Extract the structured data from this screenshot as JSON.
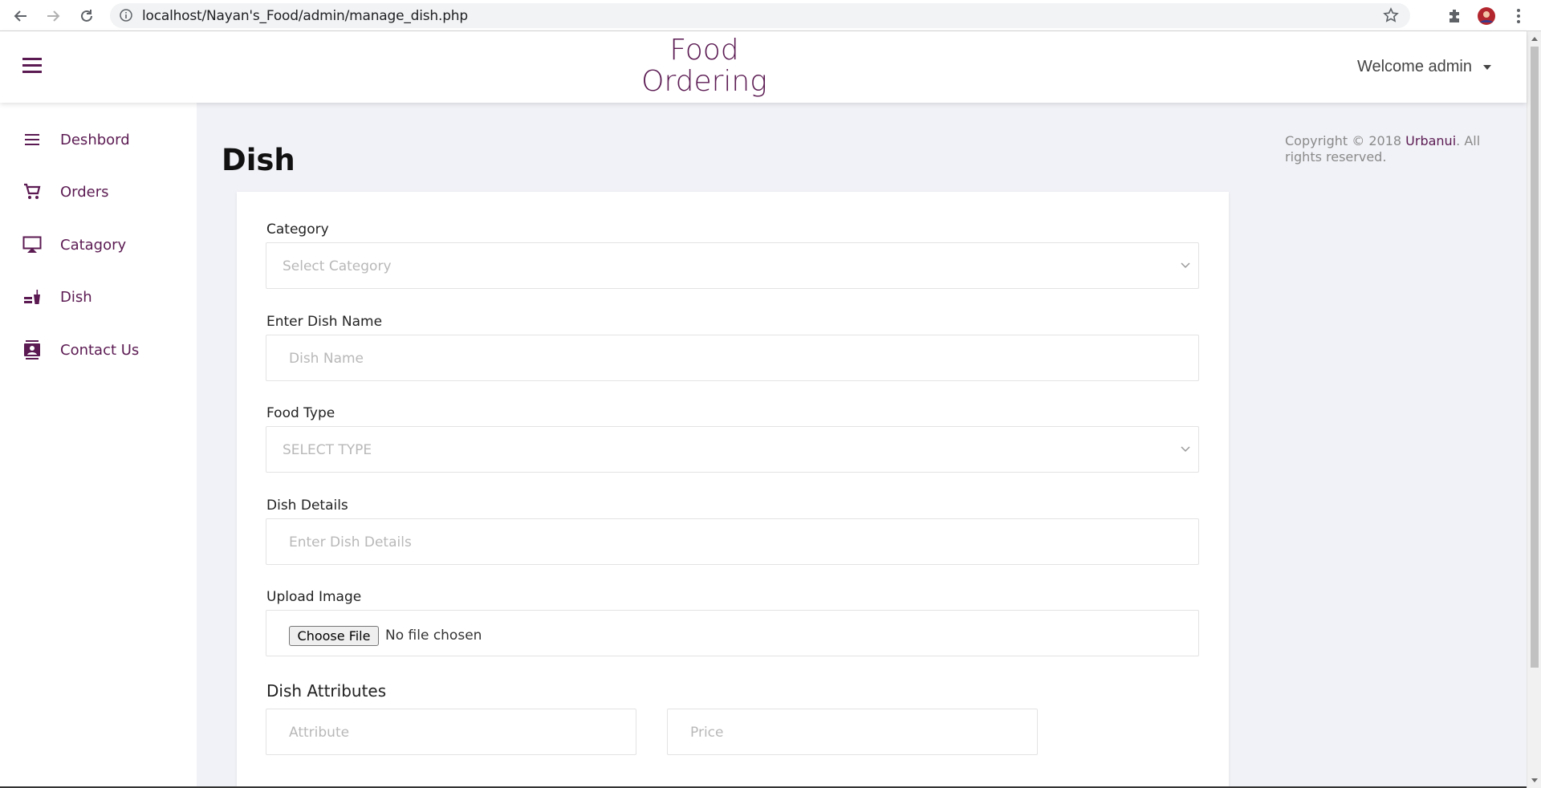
{
  "browser": {
    "url": "localhost/Nayan's_Food/admin/manage_dish.php"
  },
  "header": {
    "brand_line1": "Food",
    "brand_line2": "Ordering",
    "user_greeting": "Welcome admin"
  },
  "sidebar": {
    "items": [
      {
        "label": "Deshbord",
        "icon": "menu-icon"
      },
      {
        "label": "Orders",
        "icon": "cart-icon"
      },
      {
        "label": "Catagory",
        "icon": "airplay-icon"
      },
      {
        "label": "Dish",
        "icon": "food-drink-icon"
      },
      {
        "label": "Contact Us",
        "icon": "contacts-icon"
      }
    ]
  },
  "main": {
    "title": "Dish",
    "copyright_prefix": "Copyright © 2018 ",
    "copyright_link": "Urbanui",
    "copyright_suffix": ". All rights reserved."
  },
  "form": {
    "category_label": "Category",
    "category_placeholder": "Select Category",
    "dish_name_label": "Enter Dish Name",
    "dish_name_placeholder": "Dish Name",
    "food_type_label": "Food Type",
    "food_type_placeholder": "SELECT TYPE",
    "dish_details_label": "Dish Details",
    "dish_details_placeholder": "Enter Dish Details",
    "upload_label": "Upload Image",
    "choose_file": "Choose File",
    "no_file": "No file chosen",
    "attributes_title": "Dish Attributes",
    "attribute_placeholder": "Attribute",
    "price_placeholder": "Price"
  },
  "colors": {
    "accent": "#5b1a52",
    "background": "#f1f2f7"
  }
}
